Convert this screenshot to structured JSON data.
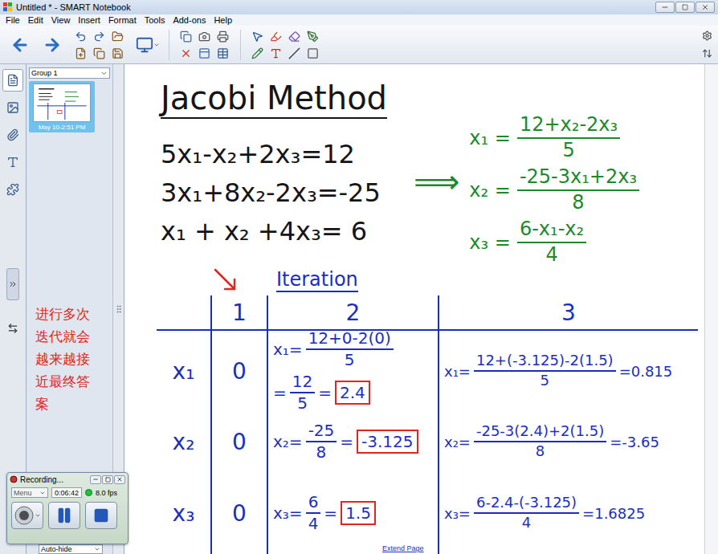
{
  "window": {
    "title": "Untitled * - SMART Notebook"
  },
  "menu": [
    "File",
    "Edit",
    "View",
    "Insert",
    "Format",
    "Tools",
    "Add-ons",
    "Help"
  ],
  "side_tabs": [
    {
      "selected": true
    },
    {
      "selected": false
    },
    {
      "selected": false
    },
    {
      "selected": false
    },
    {
      "selected": false
    }
  ],
  "page_sorter": {
    "group": "Group 1",
    "pages": [
      {
        "caption": "May 10-2:51 PM",
        "selected": true
      }
    ],
    "auto_hide": "Auto-hide"
  },
  "note": "进行多次迭代就会越来越接近最终答案",
  "canvas": {
    "title": "Jacobi Method",
    "equations": [
      "5x₁-x₂+2x₃=12",
      "3x₁+8x₂-2x₃=-25",
      "x₁ + x₂ +4x₃= 6"
    ],
    "implies": "⟹",
    "solved": [
      {
        "lhs": "x₁ =",
        "numerator": "12+x₂-2x₃",
        "denominator": "5"
      },
      {
        "lhs": "x₂ =",
        "numerator": "-25-3x₁+2x₃",
        "denominator": "8"
      },
      {
        "lhs": "x₃ =",
        "numerator": "6-x₁-x₂",
        "denominator": "4"
      }
    ],
    "iteration_label": "Iteration",
    "columns": [
      "1",
      "2",
      "3"
    ],
    "rows": [
      {
        "label": "x₁",
        "cells": [
          {
            "lines": [
              [
                {
                  "kind": "text",
                  "text": "0"
                }
              ]
            ]
          },
          {
            "lines": [
              [
                {
                  "kind": "text",
                  "text": "x₁="
                },
                {
                  "kind": "fraction",
                  "numerator": "12+0-2(0)",
                  "denominator": "5"
                }
              ],
              [
                {
                  "kind": "text",
                  "text": "="
                },
                {
                  "kind": "fraction",
                  "numerator": "12",
                  "denominator": "5"
                },
                {
                  "kind": "text",
                  "text": "="
                },
                {
                  "kind": "boxed",
                  "text": "2.4"
                }
              ]
            ]
          },
          {
            "lines": [
              [
                {
                  "kind": "text",
                  "text": "x₁="
                },
                {
                  "kind": "fraction",
                  "numerator": "12+(-3.125)-2(1.5)",
                  "denominator": "5"
                },
                {
                  "kind": "text",
                  "text": "=0.815"
                }
              ]
            ]
          }
        ]
      },
      {
        "label": "x₂",
        "cells": [
          {
            "lines": [
              [
                {
                  "kind": "text",
                  "text": "0"
                }
              ]
            ]
          },
          {
            "lines": [
              [
                {
                  "kind": "text",
                  "text": "x₂="
                },
                {
                  "kind": "fraction",
                  "numerator": "-25",
                  "denominator": "8"
                },
                {
                  "kind": "text",
                  "text": "="
                },
                {
                  "kind": "boxed",
                  "text": "-3.125"
                }
              ]
            ]
          },
          {
            "lines": [
              [
                {
                  "kind": "text",
                  "text": "x₂="
                },
                {
                  "kind": "fraction",
                  "numerator": "-25-3(2.4)+2(1.5)",
                  "denominator": "8"
                },
                {
                  "kind": "text",
                  "text": "=-3.65"
                }
              ]
            ]
          }
        ]
      },
      {
        "label": "x₃",
        "cells": [
          {
            "lines": [
              [
                {
                  "kind": "text",
                  "text": "0"
                }
              ]
            ]
          },
          {
            "lines": [
              [
                {
                  "kind": "text",
                  "text": "x₃="
                },
                {
                  "kind": "fraction",
                  "numerator": "6",
                  "denominator": "4"
                },
                {
                  "kind": "text",
                  "text": "="
                },
                {
                  "kind": "boxed",
                  "text": "1.5"
                }
              ]
            ]
          },
          {
            "lines": [
              [
                {
                  "kind": "text",
                  "text": "x₃="
                },
                {
                  "kind": "fraction",
                  "numerator": "6-2.4-(-3.125)",
                  "denominator": "4"
                },
                {
                  "kind": "text",
                  "text": "=1.6825"
                }
              ]
            ]
          }
        ]
      }
    ]
  },
  "extend_page": "Extend Page",
  "recording": {
    "title": "Recording...",
    "menu": "Menu",
    "time": "0:06:42",
    "fps": "8.0 fps",
    "active": true
  }
}
